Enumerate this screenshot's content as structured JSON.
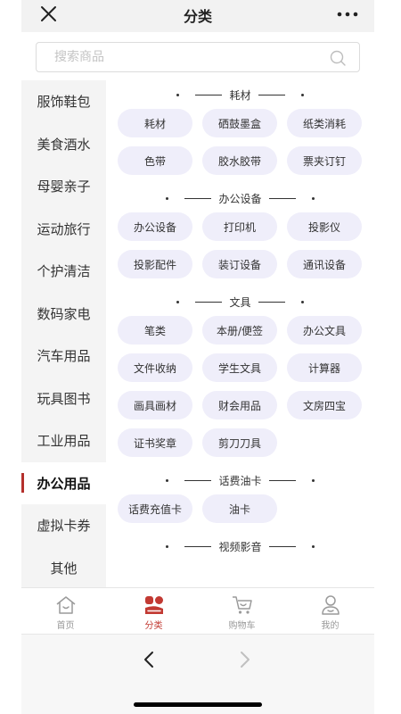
{
  "header": {
    "title": "分类",
    "close_icon": "close-icon",
    "more_icon": "more-dots-icon"
  },
  "search": {
    "placeholder": "搜索商品",
    "value": ""
  },
  "sidebar": {
    "active_color": "#b4302c",
    "items": [
      {
        "label": "服饰鞋包",
        "active": false
      },
      {
        "label": "美食酒水",
        "active": false
      },
      {
        "label": "母婴亲子",
        "active": false
      },
      {
        "label": "运动旅行",
        "active": false
      },
      {
        "label": "个护清洁",
        "active": false
      },
      {
        "label": "数码家电",
        "active": false
      },
      {
        "label": "汽车用品",
        "active": false
      },
      {
        "label": "玩具图书",
        "active": false
      },
      {
        "label": "工业用品",
        "active": false
      },
      {
        "label": "办公用品",
        "active": true
      },
      {
        "label": "虚拟卡券",
        "active": false
      },
      {
        "label": "其他",
        "active": false
      }
    ]
  },
  "sections": [
    {
      "title": "耗材",
      "tags": [
        "耗材",
        "硒鼓墨盒",
        "纸类消耗",
        "色带",
        "胶水胶带",
        "票夹订钉"
      ]
    },
    {
      "title": "办公设备",
      "tags": [
        "办公设备",
        "打印机",
        "投影仪",
        "投影配件",
        "装订设备",
        "通讯设备"
      ]
    },
    {
      "title": "文具",
      "tags": [
        "笔类",
        "本册/便签",
        "办公文具",
        "文件收纳",
        "学生文具",
        "计算器",
        "画具画材",
        "财会用品",
        "文房四宝",
        "证书奖章",
        "剪刀刀具"
      ]
    },
    {
      "title": "话费油卡",
      "tags": [
        "话费充值卡",
        "油卡"
      ]
    },
    {
      "title": "视频影音",
      "tags": []
    }
  ],
  "tabbar": {
    "active_color": "#c23a33",
    "items": [
      {
        "label": "首页",
        "icon": "home-icon",
        "active": false
      },
      {
        "label": "分类",
        "icon": "category-icon",
        "active": true
      },
      {
        "label": "购物车",
        "icon": "cart-icon",
        "active": false
      },
      {
        "label": "我的",
        "icon": "profile-icon",
        "active": false
      }
    ]
  },
  "browser_nav": {
    "back_icon": "chevron-left-icon",
    "forward_icon": "chevron-right-icon"
  }
}
